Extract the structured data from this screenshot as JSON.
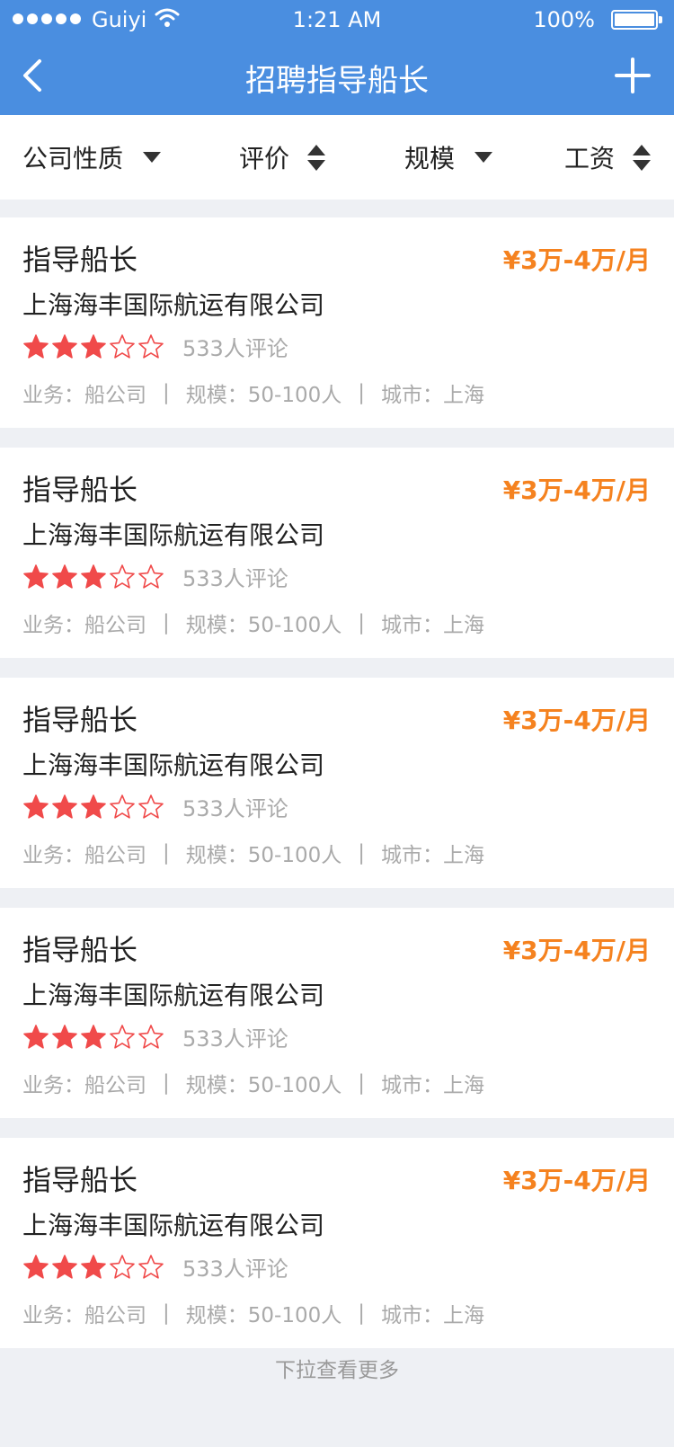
{
  "status": {
    "carrier": "Guiyi",
    "time": "1:21 AM",
    "battery": "100%"
  },
  "nav": {
    "title": "招聘指导船长"
  },
  "filters": [
    {
      "label": "公司性质",
      "kind": "dropdown"
    },
    {
      "label": "评价",
      "kind": "sort"
    },
    {
      "label": "规模",
      "kind": "dropdown"
    },
    {
      "label": "工资",
      "kind": "sort"
    }
  ],
  "colors": {
    "primary": "#4a8ee0",
    "salary": "#f5821f",
    "star": "#f04a4a"
  },
  "jobs": [
    {
      "title": "指导船长",
      "salary": "¥3万-4万/月",
      "company": "上海海丰国际航运有限公司",
      "rating": 3,
      "max_rating": 5,
      "reviews": "533人评论",
      "business": "业务：船公司",
      "scale": "规模：50-100人",
      "city": "城市：上海"
    },
    {
      "title": "指导船长",
      "salary": "¥3万-4万/月",
      "company": "上海海丰国际航运有限公司",
      "rating": 3,
      "max_rating": 5,
      "reviews": "533人评论",
      "business": "业务：船公司",
      "scale": "规模：50-100人",
      "city": "城市：上海"
    },
    {
      "title": "指导船长",
      "salary": "¥3万-4万/月",
      "company": "上海海丰国际航运有限公司",
      "rating": 3,
      "max_rating": 5,
      "reviews": "533人评论",
      "business": "业务：船公司",
      "scale": "规模：50-100人",
      "city": "城市：上海"
    },
    {
      "title": "指导船长",
      "salary": "¥3万-4万/月",
      "company": "上海海丰国际航运有限公司",
      "rating": 3,
      "max_rating": 5,
      "reviews": "533人评论",
      "business": "业务：船公司",
      "scale": "规模：50-100人",
      "city": "城市：上海"
    },
    {
      "title": "指导船长",
      "salary": "¥3万-4万/月",
      "company": "上海海丰国际航运有限公司",
      "rating": 3,
      "max_rating": 5,
      "reviews": "533人评论",
      "business": "业务：船公司",
      "scale": "规模：50-100人",
      "city": "城市：上海"
    }
  ],
  "footer": {
    "more_label": "下拉查看更多"
  }
}
